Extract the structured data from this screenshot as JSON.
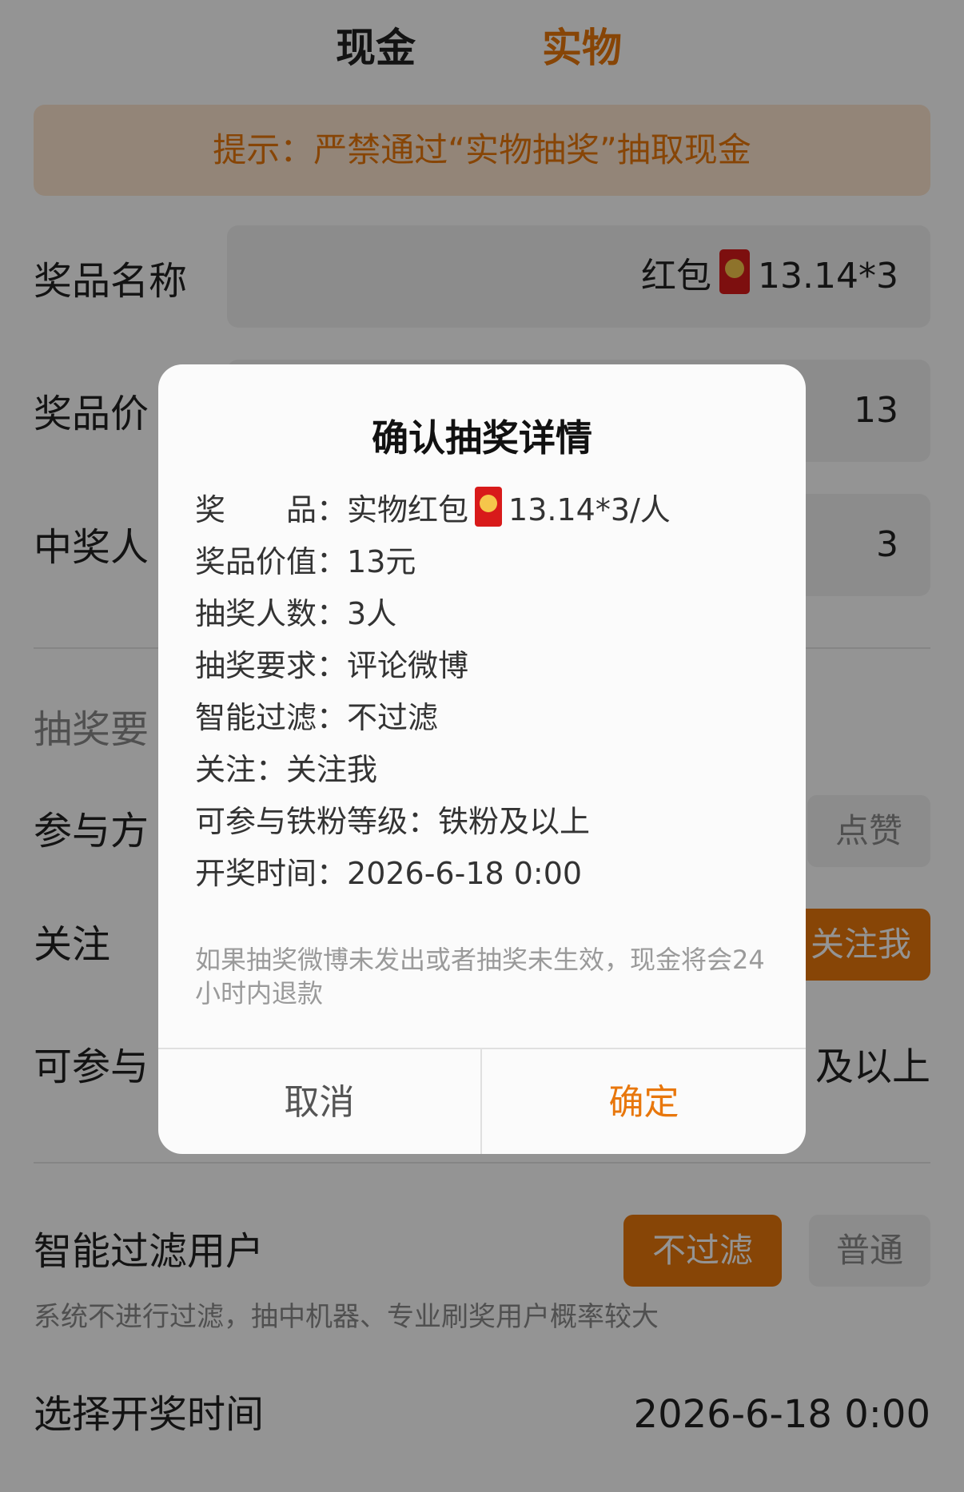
{
  "tabs": {
    "cash": "现金",
    "goods": "实物"
  },
  "tip": "提示：严禁通过“实物抽奖”抽取现金",
  "form": {
    "prize_name": {
      "label": "奖品名称",
      "value_prefix": "红包",
      "value_suffix": "13.14*3"
    },
    "prize_value": {
      "label": "奖品价",
      "value": "13"
    },
    "winners": {
      "label": "中奖人",
      "value": "3"
    },
    "requirement_section": {
      "label": "抽奖要"
    },
    "participation": {
      "label": "参与方",
      "option": "点赞"
    },
    "follow": {
      "label": "关注",
      "option": "关注我"
    },
    "fan_level": {
      "label": "可参与",
      "value": "及以上"
    },
    "smart_filter": {
      "label": "智能过滤用户",
      "options": {
        "no_filter": "不过滤",
        "normal": "普通"
      },
      "note": "系统不进行过滤，抽中机器、专业刷奖用户概率较大"
    },
    "draw_time": {
      "label": "选择开奖时间",
      "value": "2026-6-18 0:00"
    }
  },
  "modal": {
    "title": "确认抽奖详情",
    "rows": {
      "prize_label": "奖　　品：",
      "prize_value_prefix": "实物红包",
      "prize_value_suffix": "13.14*3/人",
      "worth_label": "奖品价值：",
      "worth_value": "13元",
      "count_label": "抽奖人数：",
      "count_value": "3人",
      "req_label": "抽奖要求：",
      "req_value": "评论微博",
      "filter_label": "智能过滤：",
      "filter_value": "不过滤",
      "follow_label": "关注：",
      "follow_value": "关注我",
      "fan_label": "可参与铁粉等级：",
      "fan_value": "铁粉及以上",
      "time_label": "开奖时间：",
      "time_value": "2026-6-18 0:00"
    },
    "note": "如果抽奖微博未发出或者抽奖未生效，现金将会24小时内退款",
    "cancel": "取消",
    "confirm": "确定"
  },
  "colors": {
    "accent": "#e8770c",
    "tip_bg": "#fde6cf",
    "red_packet": "#d81a1a"
  }
}
